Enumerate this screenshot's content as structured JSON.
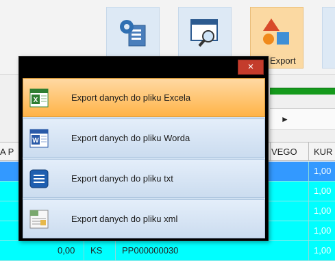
{
  "toolbar": {
    "export_label": "Export"
  },
  "grid": {
    "headers": [
      "A P",
      "VEGO",
      "KUR"
    ],
    "rows_kurs": [
      "1,00",
      "1,00",
      "1,00",
      "1,00",
      "1,00"
    ],
    "last_row": {
      "value": "0,00",
      "unit": "KS",
      "code": "PP000000030",
      "kurs": "1,00"
    }
  },
  "nav": {
    "next_arrow": "►"
  },
  "export_dialog": {
    "close_glyph": "×",
    "items": [
      {
        "label": "Export danych do pliku Excela",
        "icon": "excel-icon"
      },
      {
        "label": "Export danych do pliku Worda",
        "icon": "word-icon"
      },
      {
        "label": "Export danych do pliku txt",
        "icon": "txt-icon"
      },
      {
        "label": "Export danych do pliku xml",
        "icon": "xml-icon"
      }
    ]
  },
  "colors": {
    "row_cyan": "#00ffff",
    "row_selected": "#3399ff",
    "active_item": "#ffb347",
    "close_button": "#c43c2c"
  }
}
